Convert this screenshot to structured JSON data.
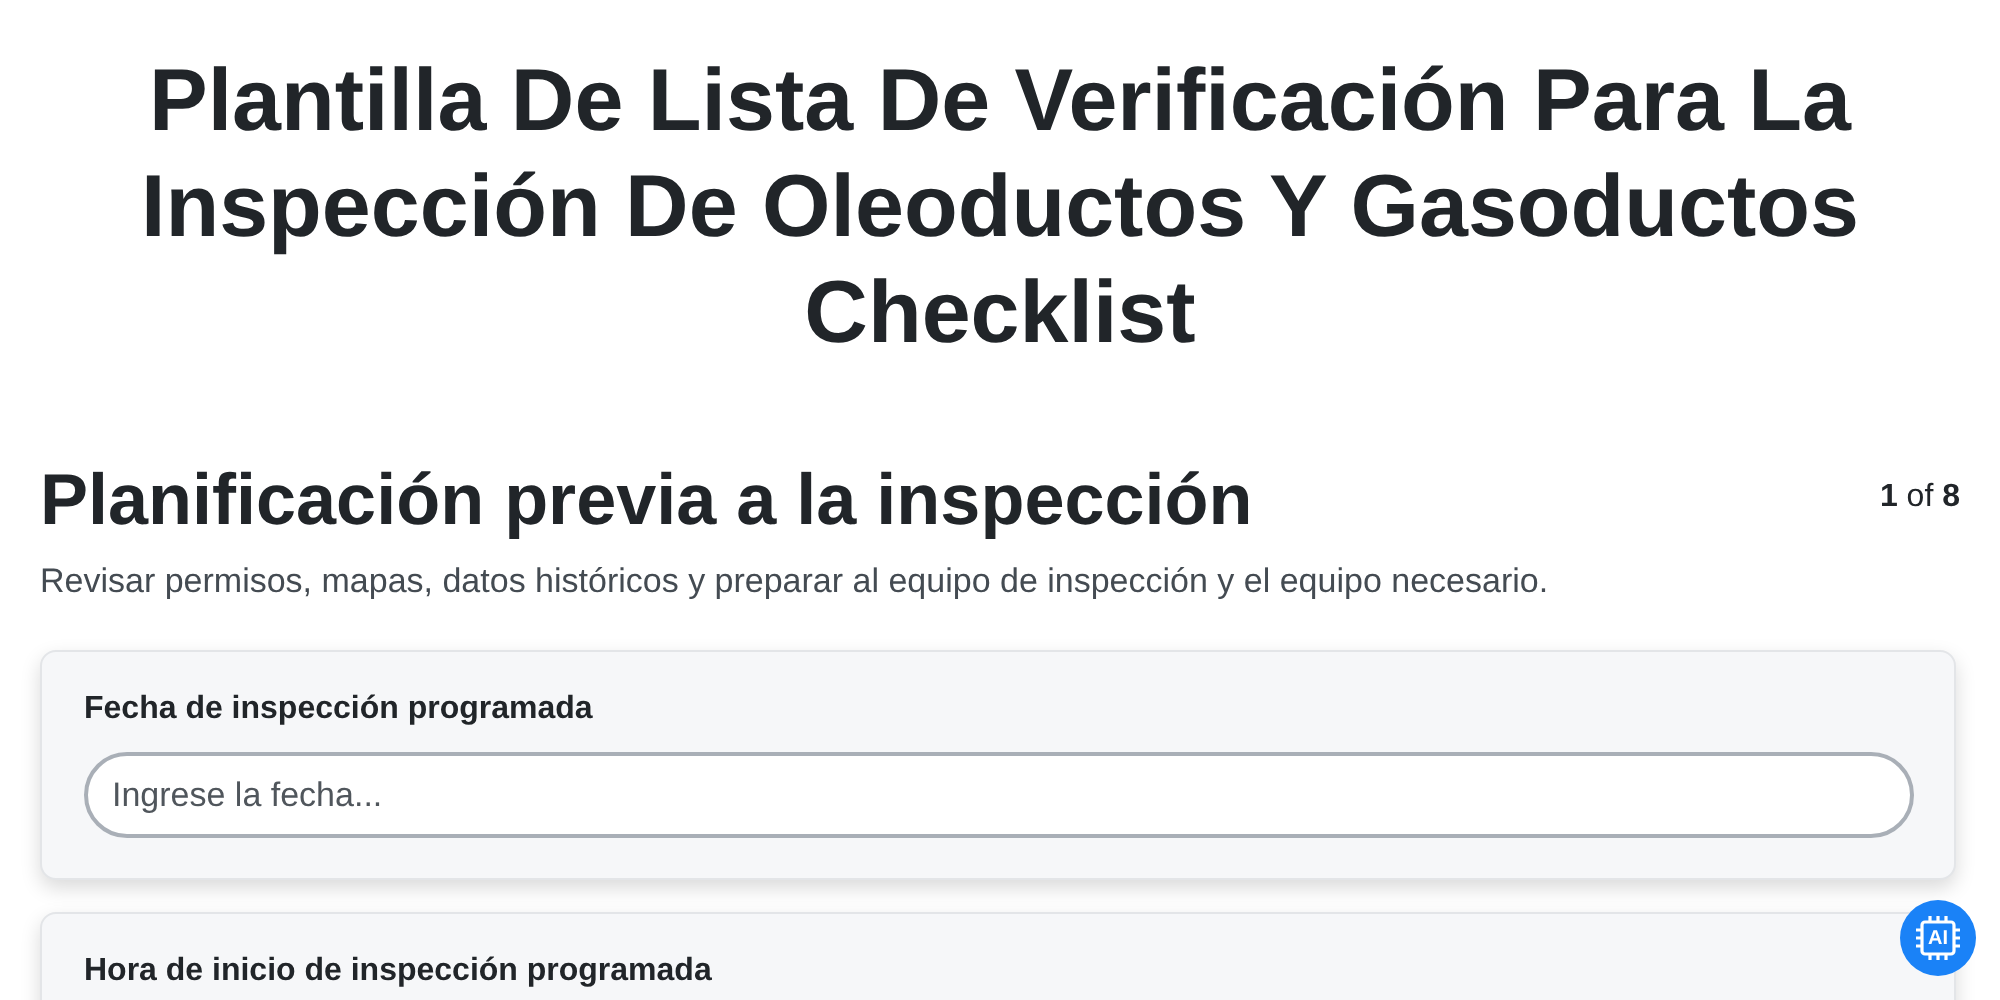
{
  "title": "Plantilla De Lista De Verificación Para La Inspección De Oleoductos Y Gasoductos Checklist",
  "section": {
    "heading": "Planificación previa a la inspección",
    "step": "1",
    "step_sep": "of",
    "step_total": "8",
    "description": "Revisar permisos, mapas, datos históricos y preparar al equipo de inspección y el equipo necesario."
  },
  "fields": [
    {
      "label": "Fecha de inspección programada",
      "placeholder": "Ingrese la fecha..."
    },
    {
      "label": "Hora de inicio de inspección programada"
    }
  ],
  "assistant_button": {
    "label": "AI"
  }
}
